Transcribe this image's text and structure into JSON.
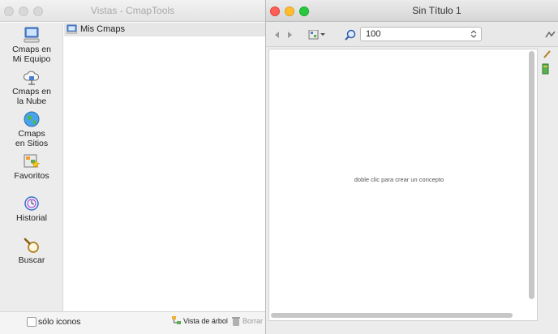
{
  "left_window": {
    "title": "Vistas - CmapTools",
    "sidebar": {
      "items": [
        {
          "label": "Cmaps en\nMi Equipo",
          "icon": "computer-icon"
        },
        {
          "label": "Cmaps en\nla Nube",
          "icon": "cloud-icon"
        },
        {
          "label": "Cmaps\nen Sitios",
          "icon": "globe-icon"
        },
        {
          "label": "Favoritos",
          "icon": "favorites-icon"
        },
        {
          "label": "Historial",
          "icon": "history-icon"
        },
        {
          "label": "Buscar",
          "icon": "search-icon"
        }
      ]
    },
    "list": {
      "items": [
        {
          "label": "Mis Cmaps",
          "icon": "folder-icon"
        }
      ]
    },
    "bottom": {
      "icons_only_label": "sólo iconos",
      "tree_view_label": "Vista de árbol",
      "delete_label": "Borrar"
    }
  },
  "right_window": {
    "title": "Sin Título 1",
    "toolbar": {
      "zoom_value": "100"
    },
    "canvas": {
      "hint": "doble clic para crear un concepto"
    }
  },
  "colors": {
    "close": "#ff5f57",
    "minimize": "#ffbd2e",
    "maximize": "#28c940"
  }
}
